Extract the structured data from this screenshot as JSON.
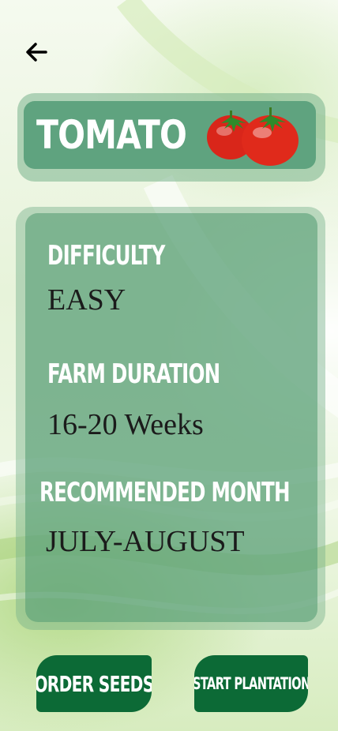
{
  "header": {
    "back_icon": "arrow-left-icon"
  },
  "crop": {
    "title": "TOMATO",
    "icon": "tomato-icon"
  },
  "details": {
    "difficulty_label": "DIFFICULTY",
    "difficulty_value": "EASY",
    "duration_label": "FARM DURATION",
    "duration_value": "16-20 Weeks",
    "month_label": "RECOMMENDED MONTH",
    "month_value": "JULY-AUGUST"
  },
  "actions": {
    "order_label": "ORDER SEEDS",
    "start_label": "START PLANTATION"
  },
  "colors": {
    "button": "#0c6a36",
    "card": "#5fa37f",
    "accent_red": "#e02a1b"
  }
}
